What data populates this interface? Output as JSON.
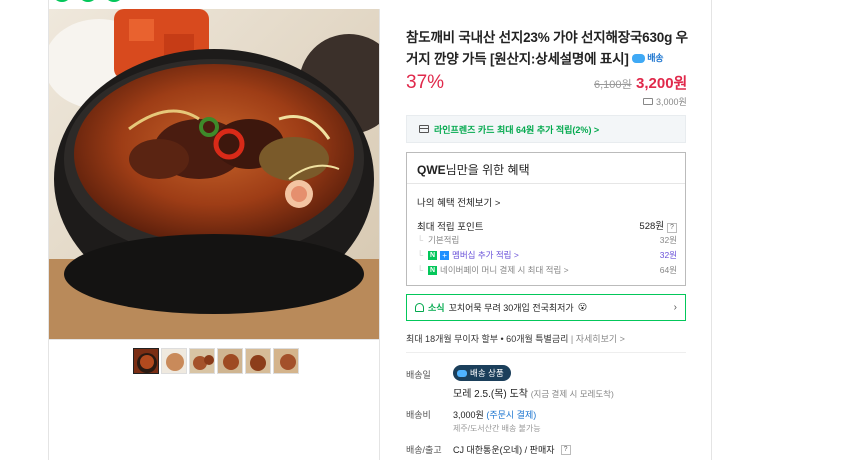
{
  "product": {
    "title": "참도깨비 국내산 선지23% 가야 선지해장국630g 우거지 깐양 가득 [원산지:상세설명에 표시]",
    "delivery_badge": "배송",
    "discount": "37%",
    "original_price": "6,100원",
    "sale_price": "3,200원",
    "shipping_fee_short": "3,000원"
  },
  "card_banner": {
    "text": "라인프렌즈 카드 최대 64원 추가 적립(2%) >"
  },
  "benefits": {
    "heading_name": "QWE",
    "heading_rest": "님만을 위한 혜택",
    "see_all": "나의 혜택 전체보기 >",
    "max_points_label": "최대 적립 포인트",
    "max_points_value": "528원",
    "help": "?",
    "rows": [
      {
        "label": "기본적립",
        "value": "32원"
      },
      {
        "label": "멤버십 추가 적립 >",
        "value": "32원"
      },
      {
        "label": "네이버페이 머니 결제 시 최대 적립 >",
        "value": "64원"
      }
    ]
  },
  "promo": {
    "prefix": "소식",
    "text": "꼬치어묵 무려 30개입 전국최저가",
    "emoji": "😮",
    "arrow": "›"
  },
  "installment": {
    "text": "최대 18개월 무이자 할부 • 60개월 특별금리",
    "link": "자세히보기 >"
  },
  "delivery": {
    "date_label": "배송일",
    "badge": "배송 상품",
    "arrival_main": "모레 2.5.(목) 도착",
    "arrival_note": "(지금 결제 시 모레도착)",
    "fee_label": "배송비",
    "fee_value": "3,000원",
    "fee_condition": "(주문시 결제)",
    "fee_note": "제주/도서산간 배송 불가능",
    "carrier_label": "배송/출고",
    "carrier_value": "CJ 대한통운(오네) / 판매자",
    "carrier_help": "?"
  },
  "colors": {
    "accent_green": "#03c75a",
    "price_red": "#e0294b",
    "badge_navy": "#1b3f5b"
  }
}
